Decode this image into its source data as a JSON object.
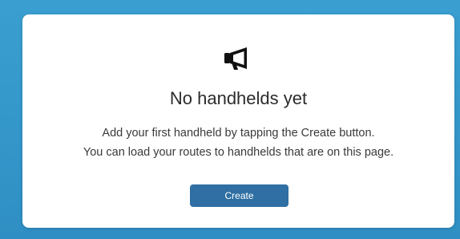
{
  "empty_state": {
    "icon": "megaphone-icon",
    "title": "No handhelds yet",
    "description_line1": "Add your first handheld by tapping the Create button.",
    "description_line2": "You can load your routes to handhelds that are on this page.",
    "create_button_label": "Create"
  },
  "colors": {
    "background": "#3a9fd0",
    "card": "#ffffff",
    "button": "#2f6fa3"
  }
}
